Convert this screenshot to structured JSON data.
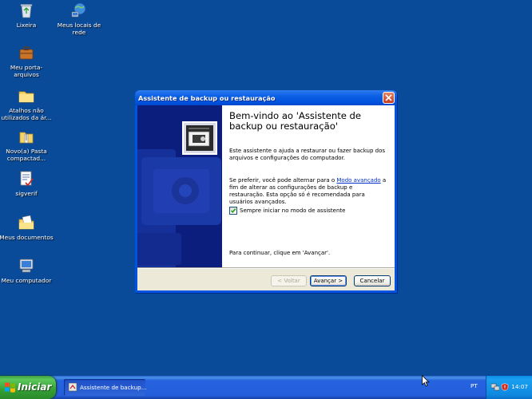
{
  "desktop": {
    "icons": [
      {
        "label": "Lixeira",
        "icon": "recycle-bin-icon"
      },
      {
        "label": "Meus locais de rede",
        "icon": "network-places-icon"
      },
      {
        "label": "Meu porta-arquivos",
        "icon": "briefcase-icon"
      },
      {
        "label": "Atalhos não utilizados da ár...",
        "icon": "folder-icon"
      },
      {
        "label": "Novo(a) Pasta compactad...",
        "icon": "zip-folder-icon"
      },
      {
        "label": "sigverif",
        "icon": "sigverif-icon"
      },
      {
        "label": "Meus documentos",
        "icon": "my-documents-icon"
      },
      {
        "label": "Meu computador",
        "icon": "my-computer-icon"
      }
    ]
  },
  "dialog": {
    "title": "Assistente de backup ou restauração",
    "heading": "Bem-vindo ao 'Assistente de backup ou restauração'",
    "intro": "Este assistente o ajuda a restaurar ou fazer backup dos arquivos e configurações do computador.",
    "advanced_prefix": "Se preferir, você pode alternar para o ",
    "advanced_link": "Modo avançado",
    "advanced_suffix": " a fim de alterar as configurações de backup e restauração. Esta opção só é recomendada para usuários avançados.",
    "checkbox_label": "Sempre iniciar no modo de assistente",
    "checkbox_checked": true,
    "continue_text": "Para continuar, clique em 'Avançar'.",
    "buttons": {
      "back": "< Voltar",
      "next": "Avançar >",
      "cancel": "Cancelar"
    }
  },
  "taskbar": {
    "start_label": "Iniciar",
    "task_label": "Assistente de backup...",
    "language": "PT",
    "clock": "14:07"
  },
  "colors": {
    "desktop": "#0a4b99",
    "side_panel": "#0c1e7d",
    "link": "#0030c8"
  }
}
